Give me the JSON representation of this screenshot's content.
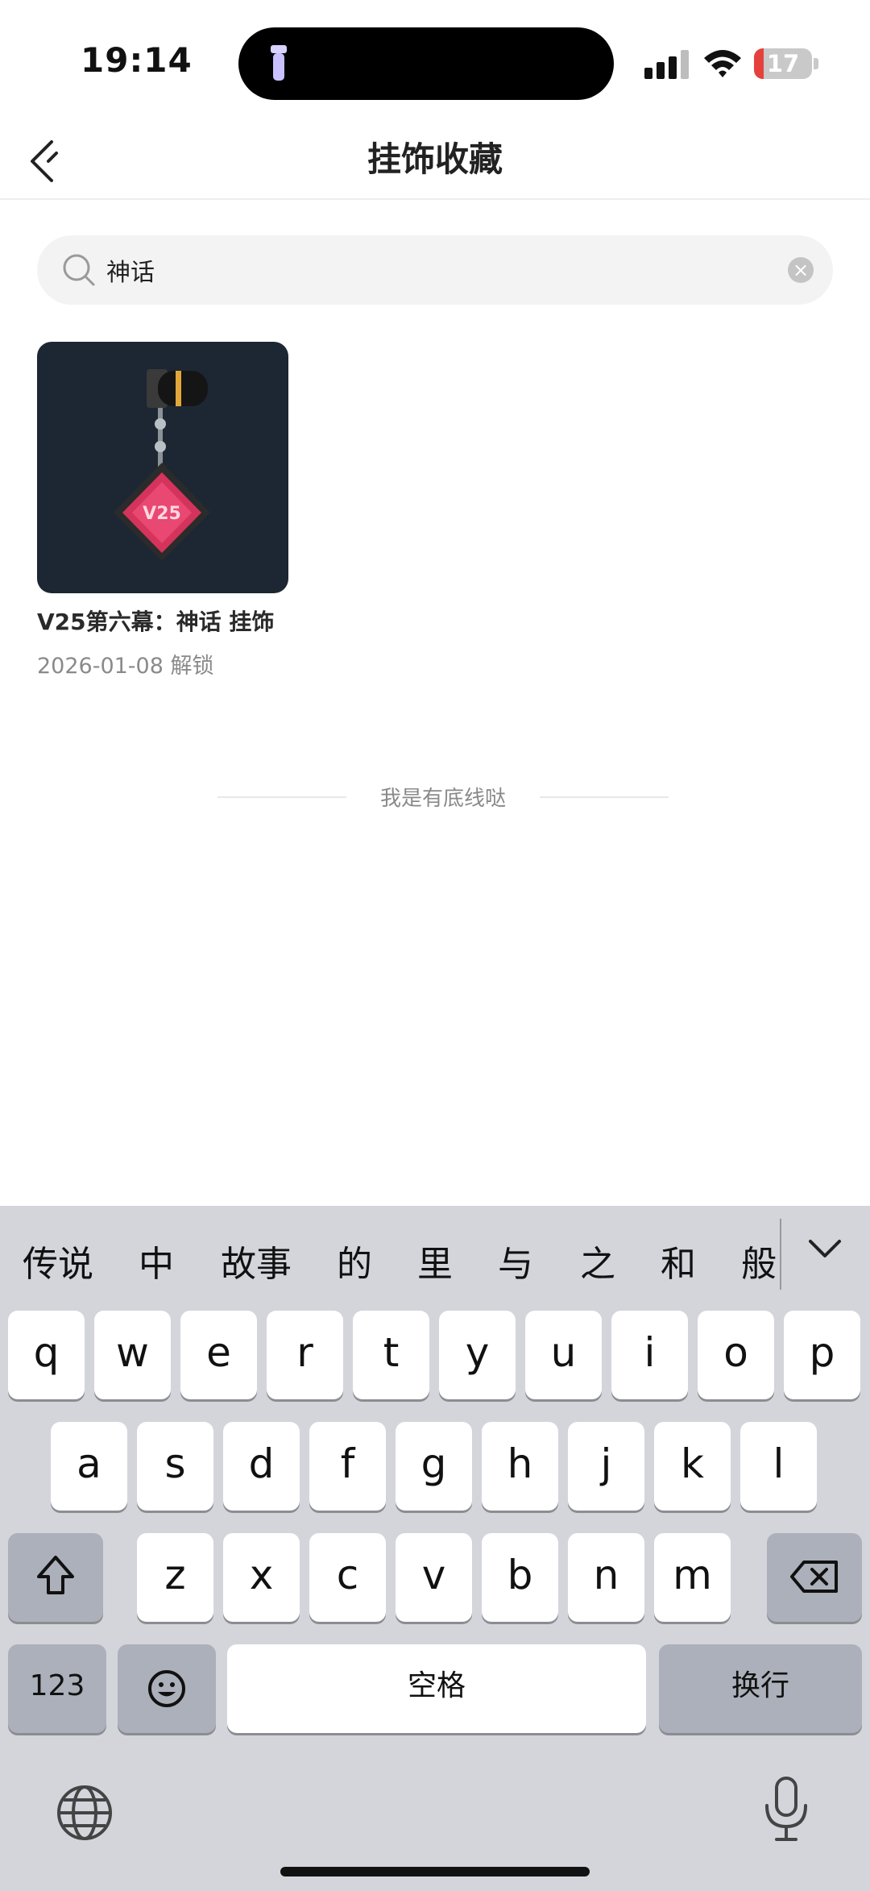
{
  "status_bar": {
    "time": "19:14",
    "battery_level": "17",
    "battery_color": "#e5413c"
  },
  "nav": {
    "title": "挂饰收藏"
  },
  "search": {
    "value": "神话",
    "placeholder": ""
  },
  "results": [
    {
      "thumb_label": "V25",
      "name": "V25第六幕：神话 挂饰",
      "date": "2026-01-08 解锁"
    }
  ],
  "end_text": "我是有底线哒",
  "keyboard": {
    "candidates": [
      "传说",
      "中",
      "故事",
      "的",
      "里",
      "与",
      "之",
      "和",
      "般"
    ],
    "row1": [
      "q",
      "w",
      "e",
      "r",
      "t",
      "y",
      "u",
      "i",
      "o",
      "p"
    ],
    "row2": [
      "a",
      "s",
      "d",
      "f",
      "g",
      "h",
      "j",
      "k",
      "l"
    ],
    "row3": [
      "z",
      "x",
      "c",
      "v",
      "b",
      "n",
      "m"
    ],
    "numbers_key": "123",
    "space_key": "空格",
    "return_key": "换行"
  }
}
